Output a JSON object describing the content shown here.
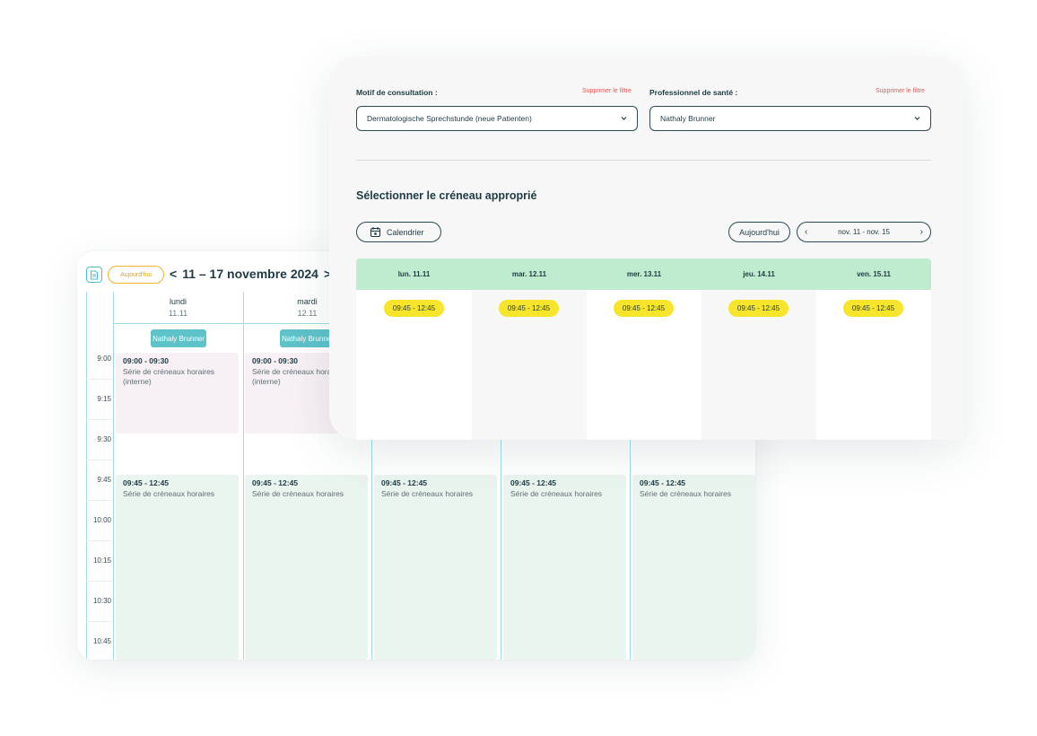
{
  "back_calendar": {
    "today_label": "Aujourd'hui",
    "prev_arrow": "<",
    "week_range": "11 – 17 novembre 2024",
    "next_arrow": ">",
    "days": [
      {
        "name": "lundi",
        "date": "11.11"
      },
      {
        "name": "mardi",
        "date": "12.11"
      }
    ],
    "professional": "Nathaly Brunner",
    "time_labels": [
      "9:00",
      "9:15",
      "9:30",
      "9:45",
      "10:00",
      "10:15",
      "10:30",
      "10:45"
    ],
    "internal_event": {
      "time": "09:00 - 09:30",
      "desc": "Série de créneaux horaires (interne)"
    },
    "slot_event": {
      "time": "09:45 - 12:45",
      "desc": "Série de créneaux horaires"
    }
  },
  "booking": {
    "reason_label": "Motif de consultation :",
    "reason_clear": "Supprimer le filtre",
    "reason_value": "Dermatologische Sprechstunde (neue Patienten)",
    "pro_label": "Professionnel de santé :",
    "pro_clear": "Supprimer le filtre",
    "pro_value": "Nathaly Brunner",
    "section_title": "Sélectionner le créneau approprié",
    "calendar_button": "Calendrier",
    "today_button": "Aujourd'hui",
    "range_label": "nov. 11 - nov. 15",
    "days": [
      "lun. 11.11",
      "mar. 12.11",
      "mer. 13.11",
      "jeu. 14.11",
      "ven. 15.11"
    ],
    "slot": "09:45 - 12:45"
  },
  "colors": {
    "accent_teal": "#5ec2c9",
    "slot_yellow": "#f6e52a",
    "header_green": "#bfeccf",
    "clear_red": "#e05a57",
    "today_orange": "#f0b429"
  }
}
